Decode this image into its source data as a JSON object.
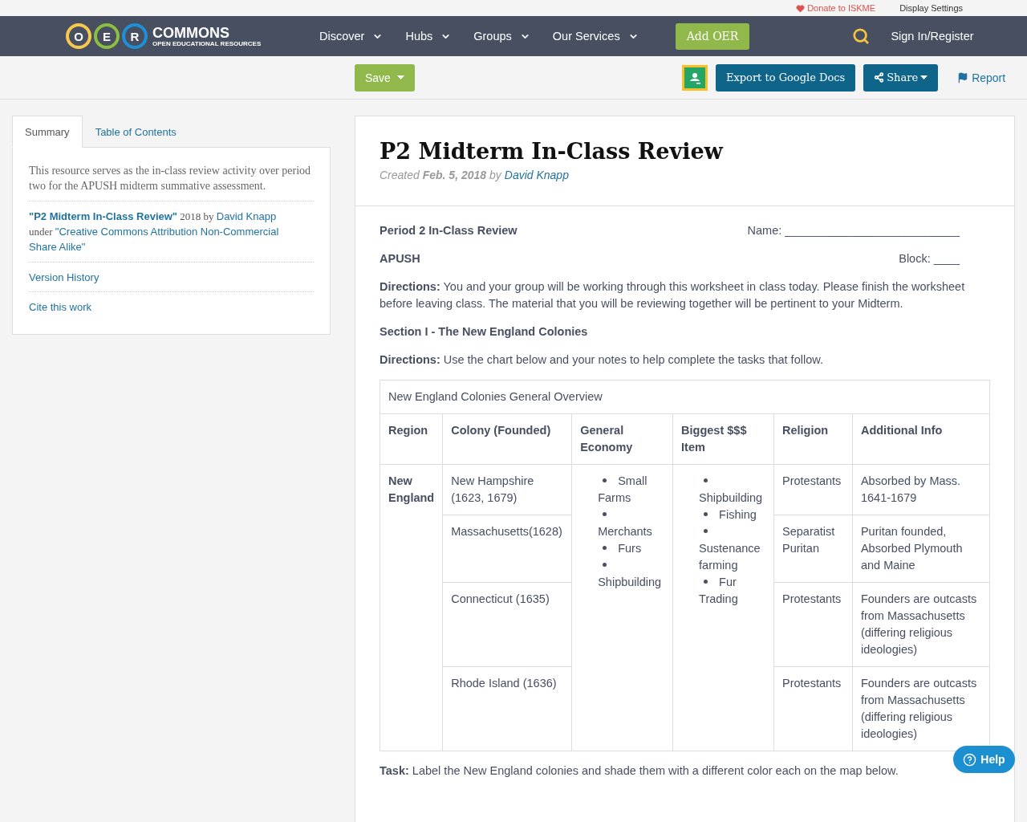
{
  "top_bar": {
    "donate": "Donate to ISKME",
    "display_settings": "Display Settings"
  },
  "nav": {
    "logo": {
      "letters": [
        "O",
        "E",
        "R"
      ],
      "name": "COMMONS",
      "tagline": "OPEN EDUCATIONAL RESOURCES"
    },
    "menu": [
      "Discover",
      "Hubs",
      "Groups",
      "Our Services"
    ],
    "add_button": "Add OER",
    "sign_in": "Sign In/Register"
  },
  "toolbar": {
    "save": "Save",
    "export": "Export to Google Docs",
    "share": "Share",
    "report": "Report"
  },
  "sidebar": {
    "tabs": [
      {
        "label": "Summary",
        "selected": true
      },
      {
        "label": "Table of Contents",
        "selected": false
      }
    ],
    "summary": "This resource serves as the in-class review activity over period two for the APUSH midterm summative assessment.",
    "attribution": {
      "title": "\"P2 Midterm In-Class Review\"",
      "year_by": "2018 by",
      "author": "David Knapp",
      "under": "under",
      "license": [
        "\"Creative Commons Attribution Non-Commercial",
        "Share Alike\""
      ]
    },
    "links": [
      "Version History",
      "Cite this work"
    ]
  },
  "resource": {
    "title": "P2 Midterm In-Class Review",
    "meta": "Created **Feb. 5, 2018** by",
    "author": "David Knapp"
  },
  "worksheet": {
    "heading": "Period 2 In-Class Review",
    "name_line": "Name: ___________________________",
    "course": "APUSH",
    "block_line": "Block: ____",
    "directions_1": "**Directions:** You and your group will be working through this worksheet in class today.  Please finish the worksheet before leaving class.  The material that you will be reviewing together will be pertinent to your Midterm.",
    "section": "Section I - The New England Colonies",
    "directions_2": "**Directions:** Use the chart below and your notes to help complete the tasks that follow.",
    "table": {
      "caption": "New England Colonies General Overview",
      "columns": [
        "Region",
        "Colony (Founded)",
        "General Economy",
        "Biggest $$$ Item",
        "Religion",
        "Additional Info"
      ],
      "region": "New England",
      "economy": [
        "Small Farms",
        "Merchants",
        "Furs",
        "Shipbuilding"
      ],
      "biggest_item": [
        "Shipbuilding",
        "Fishing",
        "Sustenance farming",
        "Fur Trading"
      ],
      "rows": [
        {
          "colony": "New Hampshire (1623, 1679)",
          "religion": "Protestants",
          "info": "Absorbed by Mass. 1641-1679"
        },
        {
          "colony": "Massachusetts(1628)",
          "religion": "Separatist Puritan",
          "info": "Puritan founded, Absorbed Plymouth and Maine"
        },
        {
          "colony": "Connecticut (1635)",
          "religion": "Protestants",
          "info": "Founders are outcasts from Massachusetts (differing religious ideologies)"
        },
        {
          "colony": "Rhode Island (1636)",
          "religion": "Protestants",
          "info": "Founders are outcasts from Massachusetts (differing religious ideologies)"
        }
      ]
    },
    "task": "**Task:** Label the New England colonies and shade them with a different color each on the map below."
  },
  "help": "Help"
}
